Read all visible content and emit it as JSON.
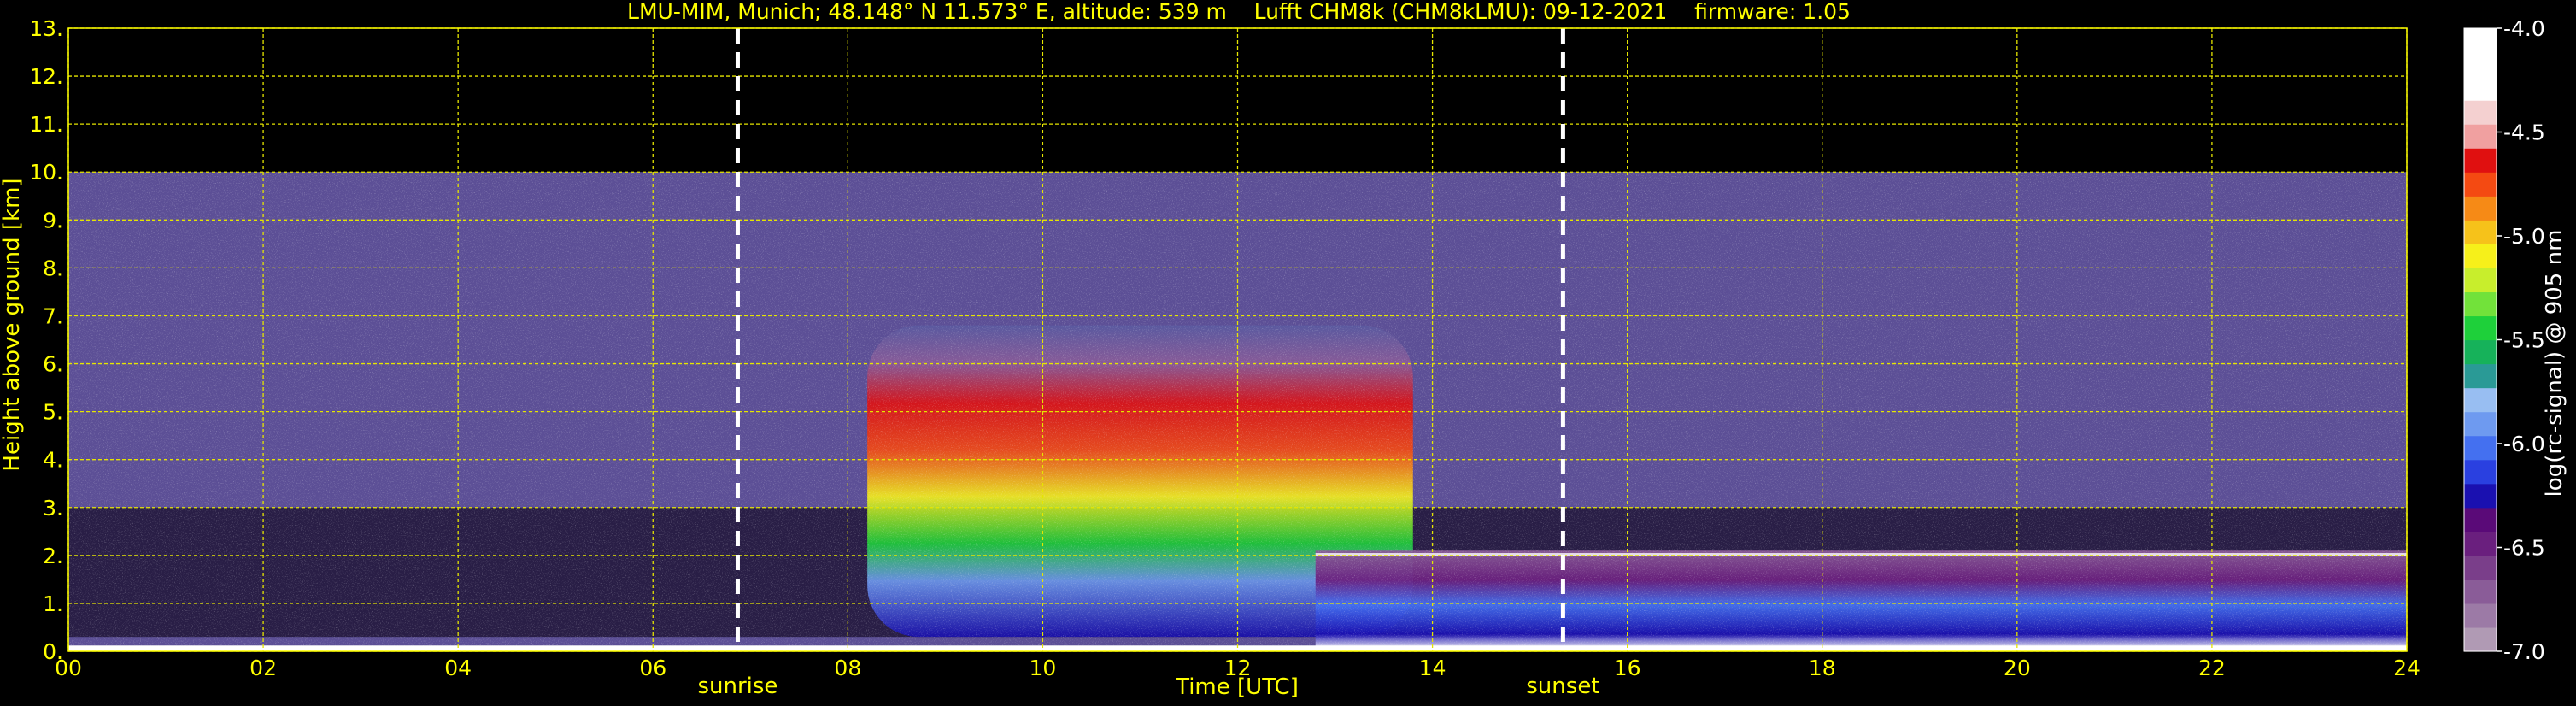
{
  "chart_data": {
    "type": "heatmap",
    "title": "LMU-MIM, Munich; 48.148° N 11.573° E, altitude: 539 m    Lufft CHM8k (CHM8kLMU): 09-12-2021    firmware: 1.05",
    "xlabel": "Time [UTC]",
    "ylabel": "Height above ground [km]",
    "xlim": [
      0,
      24
    ],
    "ylim": [
      0,
      13
    ],
    "x_ticks": [
      0,
      2,
      4,
      6,
      8,
      10,
      12,
      14,
      16,
      18,
      20,
      22,
      24
    ],
    "x_tick_labels": [
      "00",
      "02",
      "04",
      "06",
      "08",
      "10",
      "12",
      "14",
      "16",
      "18",
      "20",
      "22",
      "24"
    ],
    "y_ticks": [
      0,
      1,
      2,
      3,
      4,
      5,
      6,
      7,
      8,
      9,
      10,
      11,
      12,
      13
    ],
    "y_tick_labels": [
      "0.",
      "1.",
      "2.",
      "3.",
      "4.",
      "5.",
      "6.",
      "7.",
      "8.",
      "9.",
      "10.",
      "11.",
      "12.",
      "13."
    ],
    "grid": true,
    "data_top_km": 10,
    "markers": [
      {
        "label": "sunrise",
        "time": 6.87
      },
      {
        "label": "sunset",
        "time": 15.34
      }
    ],
    "colorbar": {
      "label": "log(rc-signal) @ 905 nm",
      "min": -7.0,
      "max": -4.0,
      "tick_values": [
        -4.0,
        -4.5,
        -5.0,
        -5.5,
        -6.0,
        -6.5,
        -7.0
      ],
      "tick_labels": [
        "-4.0",
        "-4.5",
        "-5.0",
        "-5.5",
        "-6.0",
        "-6.5",
        "-7.0"
      ],
      "colors": [
        "#b09ab4",
        "#9c7aa6",
        "#8a5c98",
        "#7a3e8a",
        "#6a1f7e",
        "#5a0a78",
        "#1a10b0",
        "#2a40e0",
        "#4470f0",
        "#6e9af0",
        "#98bef2",
        "#2a9a96",
        "#16b25a",
        "#1ed03a",
        "#72e23a",
        "#c8ee2c",
        "#f6f01a",
        "#f6c21a",
        "#f68a16",
        "#f44a12",
        "#e01010",
        "#f0a0a0",
        "#f4d0d0",
        "#ffffff",
        "#ffffff",
        "#ffffff"
      ]
    }
  }
}
